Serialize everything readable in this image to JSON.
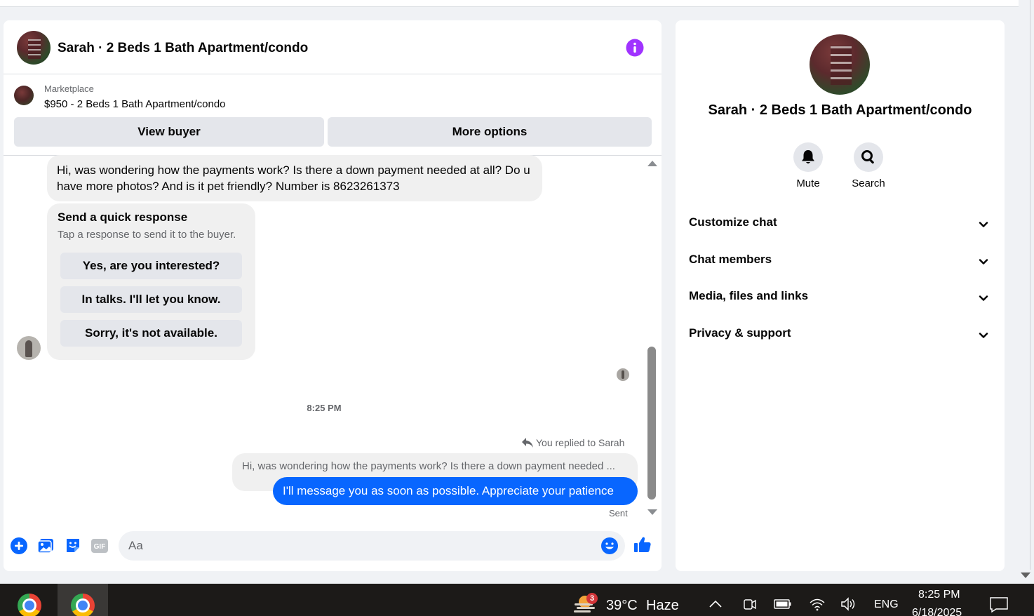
{
  "chat": {
    "title": "Sarah · 2 Beds 1 Bath Apartment/condo",
    "listing": {
      "source": "Marketplace",
      "price_title": "$950 - 2 Beds 1 Bath Apartment/condo",
      "view_buyer_label": "View buyer",
      "more_options_label": "More options"
    },
    "messages": {
      "incoming_text": "Hi, was wondering how the payments work? Is there a down payment needed at all? Do u have more photos? And is it pet friendly? Number is 8623261373",
      "quick_response": {
        "title": "Send a quick response",
        "subtitle": "Tap a response to send it to the buyer.",
        "options": [
          "Yes, are you interested?",
          "In talks. I'll let you know.",
          "Sorry, it's not available."
        ]
      },
      "timestamp": "8:25 PM",
      "replied_label": "You replied to Sarah",
      "quoted_text": "Hi, was wondering how the payments work? Is there a down payment needed ...",
      "outgoing_text": "I'll message you as soon as possible. Appreciate your patience",
      "status": "Sent"
    },
    "composer": {
      "placeholder": "Aa"
    }
  },
  "info_panel": {
    "name": "Sarah · 2 Beds 1 Bath Apartment/condo",
    "actions": [
      {
        "label": "Mute",
        "icon": "bell-icon"
      },
      {
        "label": "Search",
        "icon": "search-icon"
      }
    ],
    "sections": [
      "Customize chat",
      "Chat members",
      "Media, files and links",
      "Privacy & support"
    ]
  },
  "taskbar": {
    "weather_badge": "3",
    "temperature": "39°C",
    "condition": "Haze",
    "language": "ENG",
    "time": "8:25 PM",
    "date": "6/18/2025"
  },
  "colors": {
    "accent": "#0866ff",
    "info_icon": "#a033ff",
    "bubble_gray": "#f0f0f0",
    "button_gray": "#e4e6eb"
  }
}
